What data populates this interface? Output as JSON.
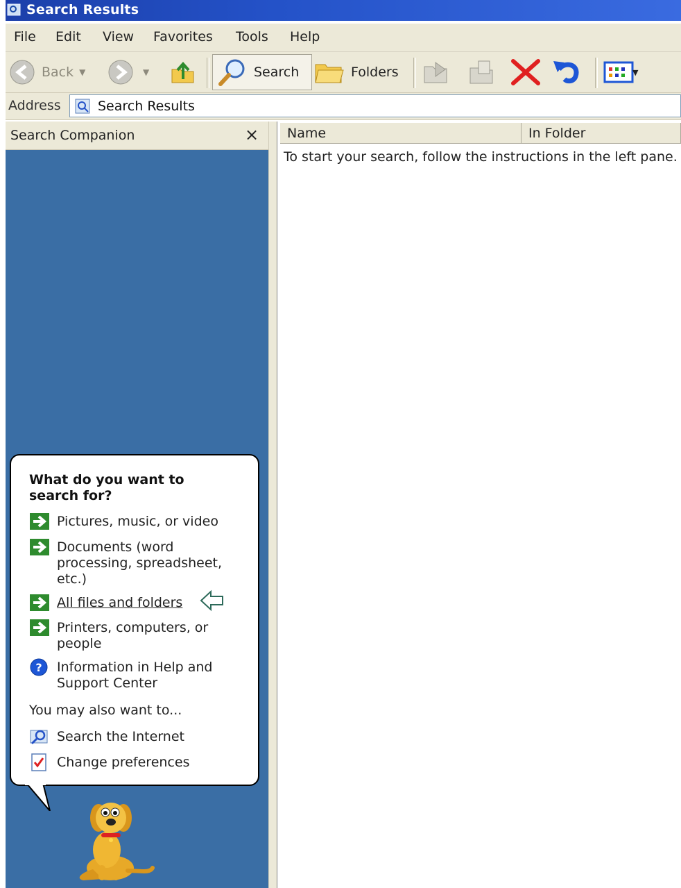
{
  "window": {
    "title": "Search Results"
  },
  "menu": [
    "File",
    "Edit",
    "View",
    "Favorites",
    "Tools",
    "Help"
  ],
  "toolbar": {
    "back_label": "Back",
    "search_label": "Search",
    "folders_label": "Folders"
  },
  "address": {
    "label": "Address",
    "value": "Search Results"
  },
  "left_pane": {
    "title": "Search Companion",
    "close_glyph": "×",
    "question": "What do you want to search for?",
    "options": [
      "Pictures, music, or video",
      "Documents (word processing, spreadsheet, etc.)",
      "All files and folders",
      "Printers, computers, or people",
      "Information in Help and Support Center"
    ],
    "also_label": "You may also want to...",
    "extra": [
      "Search the Internet",
      "Change preferences"
    ]
  },
  "results": {
    "columns": [
      "Name",
      "In Folder"
    ],
    "hint": "To start your search, follow the instructions in the left pane."
  },
  "colors": {
    "pane_blue": "#3a6ea5",
    "title_blue": "#2452c8",
    "arrow_green": "#2e8b2e",
    "delete_red": "#e02020"
  }
}
